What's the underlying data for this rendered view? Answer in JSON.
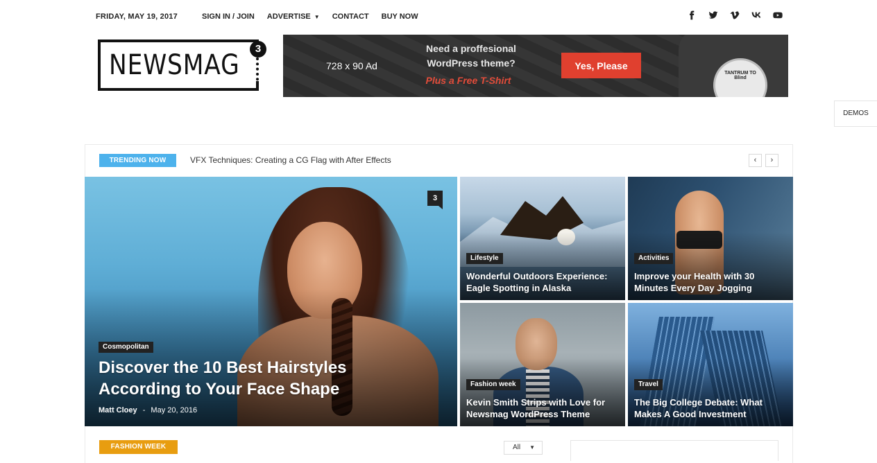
{
  "topbar": {
    "date": "FRIDAY, MAY 19, 2017",
    "menu": [
      "SIGN IN / JOIN",
      "ADVERTISE",
      "CONTACT",
      "BUY NOW"
    ],
    "social_icons": [
      "facebook-icon",
      "twitter-icon",
      "vimeo-icon",
      "vk-icon",
      "youtube-icon"
    ]
  },
  "logo": {
    "text": "NEWSMAG",
    "badge": "3"
  },
  "ad": {
    "size": "728 x 90 Ad",
    "line1": "Need a proffesional",
    "line2": "WordPress theme?",
    "line3": "Plus a Free T-Shirt",
    "button": "Yes, Please",
    "shirt_text": "TANTRUM TO Blind"
  },
  "demos": "DEMOS",
  "trending": {
    "badge": "TRENDING NOW",
    "title": "VFX Techniques: Creating a CG Flag with After Effects",
    "prev": "‹",
    "next": "›"
  },
  "featured": {
    "category": "Cosmopolitan",
    "title": "Discover the 10 Best Hairstyles According to Your Face Shape",
    "author": "Matt Cloey",
    "separator": "-",
    "date": "May 20, 2016",
    "comments": "3"
  },
  "tiles": [
    {
      "category": "Lifestyle",
      "title": "Wonderful Outdoors Experience: Eagle Spotting in Alaska"
    },
    {
      "category": "Activities",
      "title": "Improve your Health with 30 Minutes Every Day Jogging"
    },
    {
      "category": "Fashion week",
      "title": "Kevin Smith Strips with Love for Newsmag WordPress Theme"
    },
    {
      "category": "Travel",
      "title": "The Big College Debate: What Makes A Good Investment"
    }
  ],
  "section": {
    "badge": "FASHION WEEK",
    "filter": "All"
  },
  "colors": {
    "accent": "#4db2ec",
    "fashion": "#e89d10",
    "ad_button": "#e0402f"
  }
}
